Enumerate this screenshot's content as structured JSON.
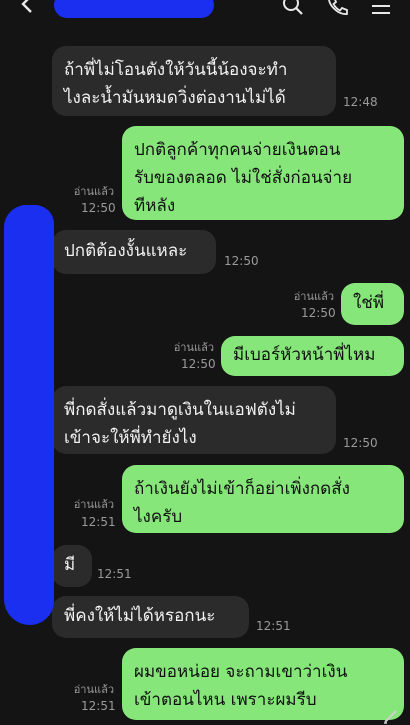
{
  "header": {
    "icons": [
      "back-icon",
      "search-icon",
      "phone-icon",
      "menu-icon"
    ]
  },
  "messages": [
    {
      "side": "in",
      "text": "ถ้าพี่ไม่โอนตังให้วันนี้น้องจะทำ\nไงละน้ำมันหมดวิ่งต่องานไม่ได้",
      "time": "12:48",
      "read": ""
    },
    {
      "side": "out",
      "text": "ปกติลูกค้าทุกคนจ่ายเงินตอน\nรับของตลอด  ไม่ใช่สั่งก่อนจ่าย\nทีหลัง",
      "time": "12:50",
      "read": "อ่านแล้ว"
    },
    {
      "side": "in",
      "text": "ปกติต้องงั้นแหละ",
      "time": "12:50",
      "read": ""
    },
    {
      "side": "out",
      "text": "ใช่พี่",
      "time": "12:50",
      "read": "อ่านแล้ว"
    },
    {
      "side": "out",
      "text": "มีเบอร์หัวหน้าพี่ไหม",
      "time": "12:50",
      "read": "อ่านแล้ว"
    },
    {
      "side": "in",
      "text": "พี่กดสั่งแล้วมาดูเงินในแอฟตังไม่\nเข้าจะให้พี่ทำยังไง",
      "time": "12:50",
      "read": ""
    },
    {
      "side": "out",
      "text": "ถ้าเงินยังไม่เข้าก็อย่าเพิ่งกดสั่ง\nไงครับ",
      "time": "12:51",
      "read": "อ่านแล้ว"
    },
    {
      "side": "in",
      "text": "มี",
      "time": "12:51",
      "read": ""
    },
    {
      "side": "in",
      "text": "พี่คงให้ไม่ได้หรอกนะ",
      "time": "12:51",
      "read": ""
    },
    {
      "side": "out",
      "text": "ผมขอหน่อย จะถามเขาว่าเงิน\nเข้าตอนไหน เพราะผมรีบ",
      "time": "12:51",
      "read": "อ่านแล้ว"
    }
  ]
}
